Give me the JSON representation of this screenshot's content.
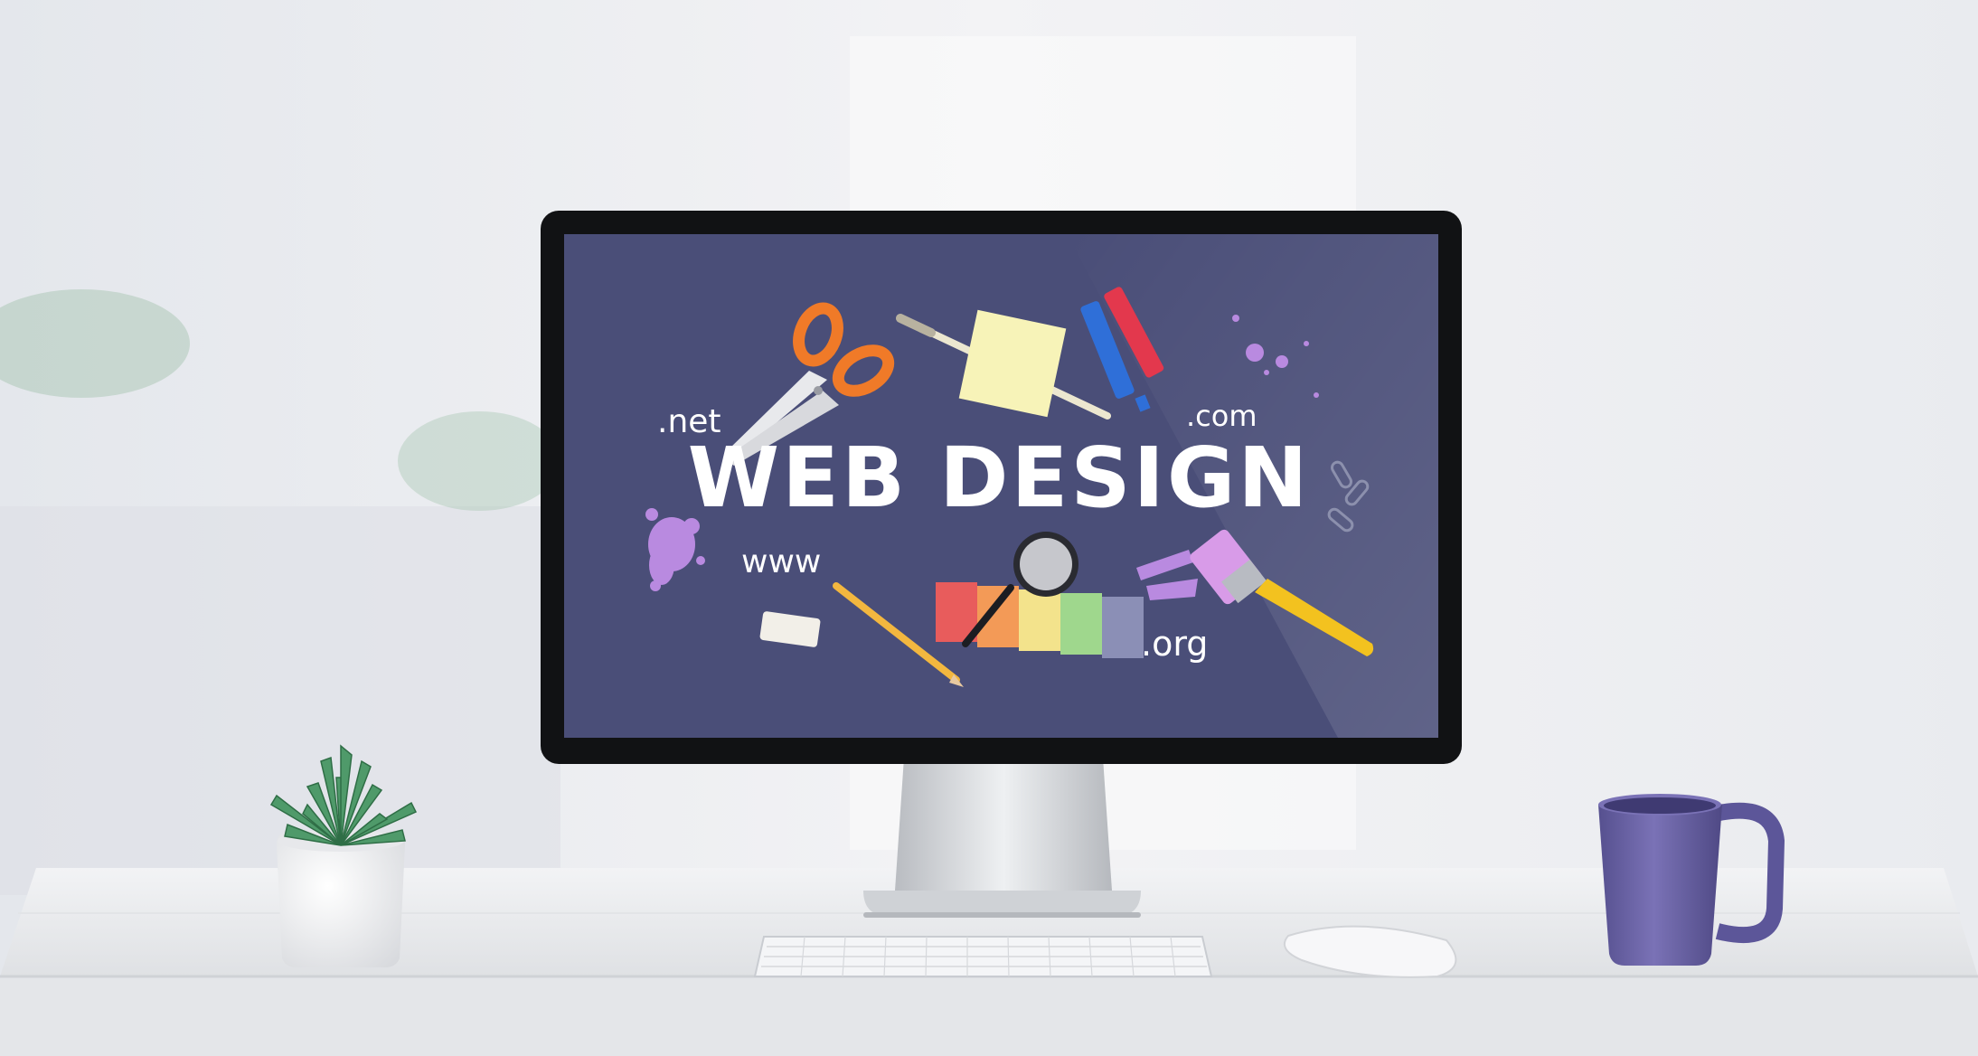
{
  "screen": {
    "title": "WEB DESIGN",
    "domains": {
      "net": ".net",
      "com": ".com",
      "www": "www",
      "org": ".org"
    },
    "background_color": "#4a4e78"
  },
  "swatch_colors": [
    "#e85c5c",
    "#f39a57",
    "#f3e38c",
    "#9fd78d",
    "#8b8fb6"
  ],
  "icons": [
    "scissors-icon",
    "paintbrush-icon",
    "sticky-note-icon",
    "paint-tubes-icon",
    "magnifier-icon",
    "pencil-icon",
    "eraser-icon",
    "paperclip-icon",
    "paint-splash-icon"
  ],
  "desk_objects": [
    "monitor",
    "keyboard",
    "mouse",
    "mug",
    "succulent-plant"
  ],
  "colors": {
    "mug": "#6b62a6",
    "plant": "#4f9a6a",
    "desk": "#e7e9ec"
  }
}
